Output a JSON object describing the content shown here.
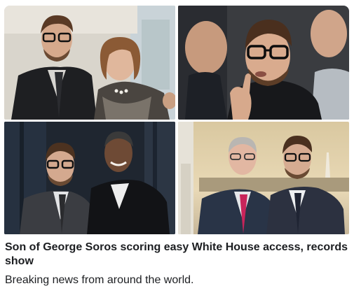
{
  "post": {
    "headline": "Son of George Soros scoring easy White House access, records show",
    "description": "Breaking news from around the world."
  },
  "colors": {
    "text": "#1c1e21",
    "background": "#ffffff"
  }
}
